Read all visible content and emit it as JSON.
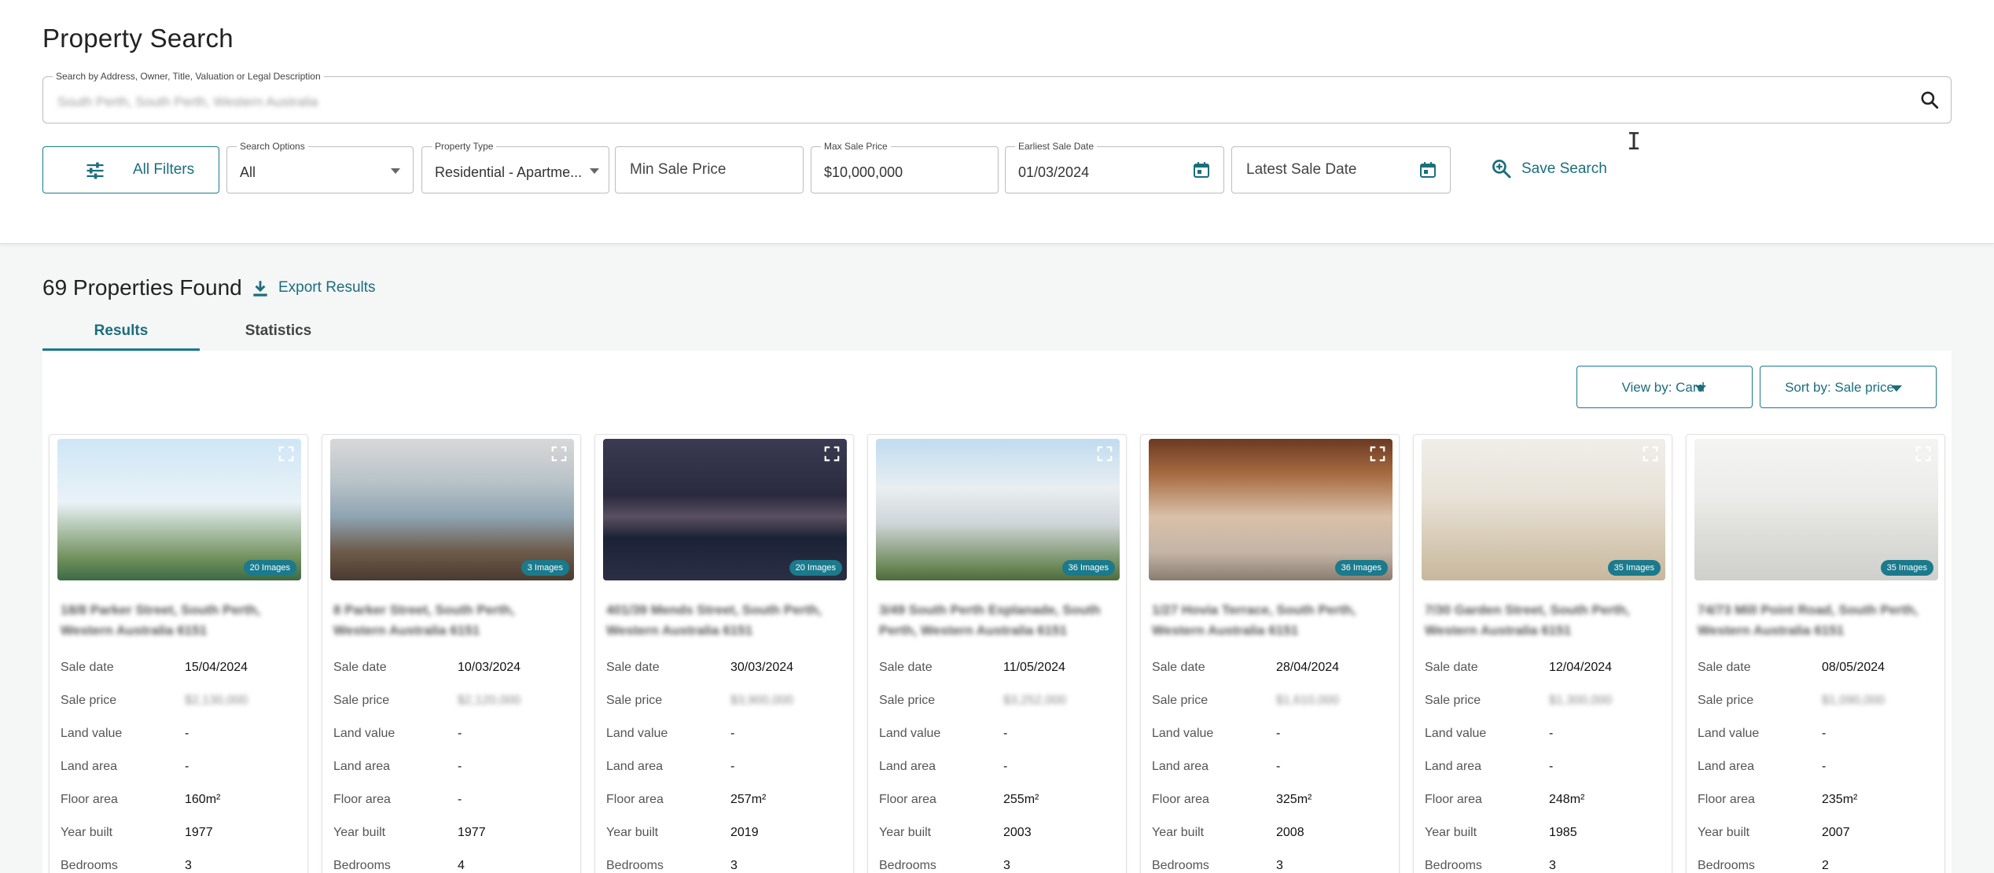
{
  "page": {
    "title": "Property Search"
  },
  "search": {
    "label": "Search by Address, Owner, Title, Valuation or Legal Description",
    "value": "South Perth, South Perth, Western Australia"
  },
  "filters": {
    "all_filters_label": "All Filters",
    "search_options": {
      "label": "Search Options",
      "value": "All"
    },
    "property_type": {
      "label": "Property Type",
      "value": "Residential - Apartme..."
    },
    "min_sale_price": {
      "placeholder": "Min Sale Price"
    },
    "max_sale_price": {
      "label": "Max Sale Price",
      "value": "$10,000,000"
    },
    "earliest_sale_date": {
      "label": "Earliest Sale Date",
      "value": "01/03/2024"
    },
    "latest_sale_date": {
      "placeholder": "Latest Sale Date"
    },
    "save_search_label": "Save Search"
  },
  "results": {
    "count_text": "69 Properties Found",
    "export_label": "Export Results",
    "tabs": [
      {
        "label": "Results",
        "active": true
      },
      {
        "label": "Statistics",
        "active": false
      }
    ],
    "view_by": "View by: Card",
    "sort_by": "Sort by: Sale price"
  },
  "row_labels": {
    "sale_date": "Sale date",
    "sale_price": "Sale price",
    "land_value": "Land value",
    "land_area": "Land area",
    "floor_area": "Floor area",
    "year_built": "Year built",
    "bedrooms": "Bedrooms"
  },
  "cards": [
    {
      "address": "18/8 Parker Street, South Perth, Western Australia 6151",
      "images": "20 Images",
      "sale_date": "15/04/2024",
      "sale_price": "$2,130,000",
      "land_value": "-",
      "land_area": "-",
      "floor_area": "160m²",
      "year_built": "1977",
      "bedrooms": "3"
    },
    {
      "address": "8 Parker Street, South Perth, Western Australia 6151",
      "images": "3 Images",
      "sale_date": "10/03/2024",
      "sale_price": "$2,120,000",
      "land_value": "-",
      "land_area": "-",
      "floor_area": "-",
      "year_built": "1977",
      "bedrooms": "4"
    },
    {
      "address": "401/39 Mends Street, South Perth, Western Australia 6151",
      "images": "20 Images",
      "sale_date": "30/03/2024",
      "sale_price": "$3,900,000",
      "land_value": "-",
      "land_area": "-",
      "floor_area": "257m²",
      "year_built": "2019",
      "bedrooms": "3"
    },
    {
      "address": "3/49 South Perth Esplanade, South Perth, Western Australia 6151",
      "images": "36 Images",
      "sale_date": "11/05/2024",
      "sale_price": "$3,252,000",
      "land_value": "-",
      "land_area": "-",
      "floor_area": "255m²",
      "year_built": "2003",
      "bedrooms": "3"
    },
    {
      "address": "1/27 Hovia Terrace, South Perth, Western Australia 6151",
      "images": "36 Images",
      "sale_date": "28/04/2024",
      "sale_price": "$1,610,000",
      "land_value": "-",
      "land_area": "-",
      "floor_area": "325m²",
      "year_built": "2008",
      "bedrooms": "3"
    },
    {
      "address": "7/30 Garden Street, South Perth, Western Australia 6151",
      "images": "35 Images",
      "sale_date": "12/04/2024",
      "sale_price": "$1,300,000",
      "land_value": "-",
      "land_area": "-",
      "floor_area": "248m²",
      "year_built": "1985",
      "bedrooms": "3"
    },
    {
      "address": "74/73 Mill Point Road, South Perth, Western Australia 6151",
      "images": "35 Images",
      "sale_date": "08/05/2024",
      "sale_price": "$1,090,000",
      "land_value": "-",
      "land_area": "-",
      "floor_area": "235m²",
      "year_built": "2007",
      "bedrooms": "2"
    }
  ]
}
